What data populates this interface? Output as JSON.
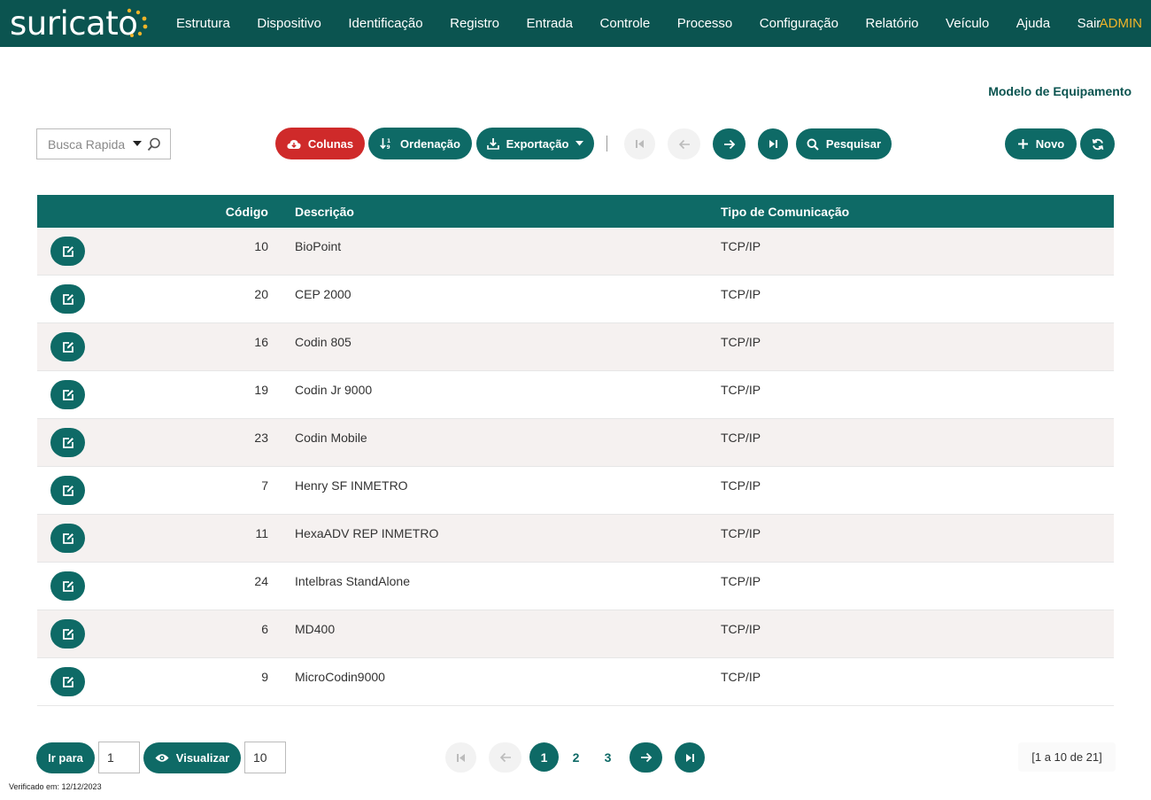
{
  "app": {
    "logo_text": "suricato",
    "user": "ADMIN"
  },
  "nav": [
    "Estrutura",
    "Dispositivo",
    "Identificação",
    "Registro",
    "Entrada",
    "Controle",
    "Processo",
    "Configuração",
    "Relatório",
    "Veículo",
    "Ajuda",
    "Sair"
  ],
  "page_title": "Modelo de Equipamento",
  "toolbar": {
    "search_placeholder": "Busca Rapida",
    "colunas": "Colunas",
    "ordenacao": "Ordenação",
    "exportacao": "Exportação",
    "pesquisar": "Pesquisar",
    "novo": "Novo"
  },
  "table": {
    "headers": {
      "codigo": "Código",
      "descricao": "Descrição",
      "tipo": "Tipo de Comunicação"
    },
    "rows": [
      {
        "codigo": "10",
        "descricao": "BioPoint",
        "tipo": "TCP/IP"
      },
      {
        "codigo": "20",
        "descricao": "CEP 2000",
        "tipo": "TCP/IP"
      },
      {
        "codigo": "16",
        "descricao": "Codin 805",
        "tipo": "TCP/IP"
      },
      {
        "codigo": "19",
        "descricao": "Codin Jr 9000",
        "tipo": "TCP/IP"
      },
      {
        "codigo": "23",
        "descricao": "Codin Mobile",
        "tipo": "TCP/IP"
      },
      {
        "codigo": "7",
        "descricao": "Henry SF INMETRO",
        "tipo": "TCP/IP"
      },
      {
        "codigo": "11",
        "descricao": "HexaADV REP INMETRO",
        "tipo": "TCP/IP"
      },
      {
        "codigo": "24",
        "descricao": "Intelbras StandAlone",
        "tipo": "TCP/IP"
      },
      {
        "codigo": "6",
        "descricao": "MD400",
        "tipo": "TCP/IP"
      },
      {
        "codigo": "9",
        "descricao": "MicroCodin9000",
        "tipo": "TCP/IP"
      }
    ]
  },
  "footer": {
    "ir_para": "Ir para",
    "ir_para_value": "1",
    "visualizar": "Visualizar",
    "visualizar_value": "10",
    "pages": [
      "1",
      "2",
      "3"
    ],
    "current_page": "1",
    "range": "[1 a 10 de 21]",
    "verified": "Verificado em: 12/12/2023"
  },
  "colors": {
    "primary": "#0e6a66",
    "topbar": "#0b5450",
    "danger": "#cf2a2a",
    "user": "#f0b429"
  }
}
